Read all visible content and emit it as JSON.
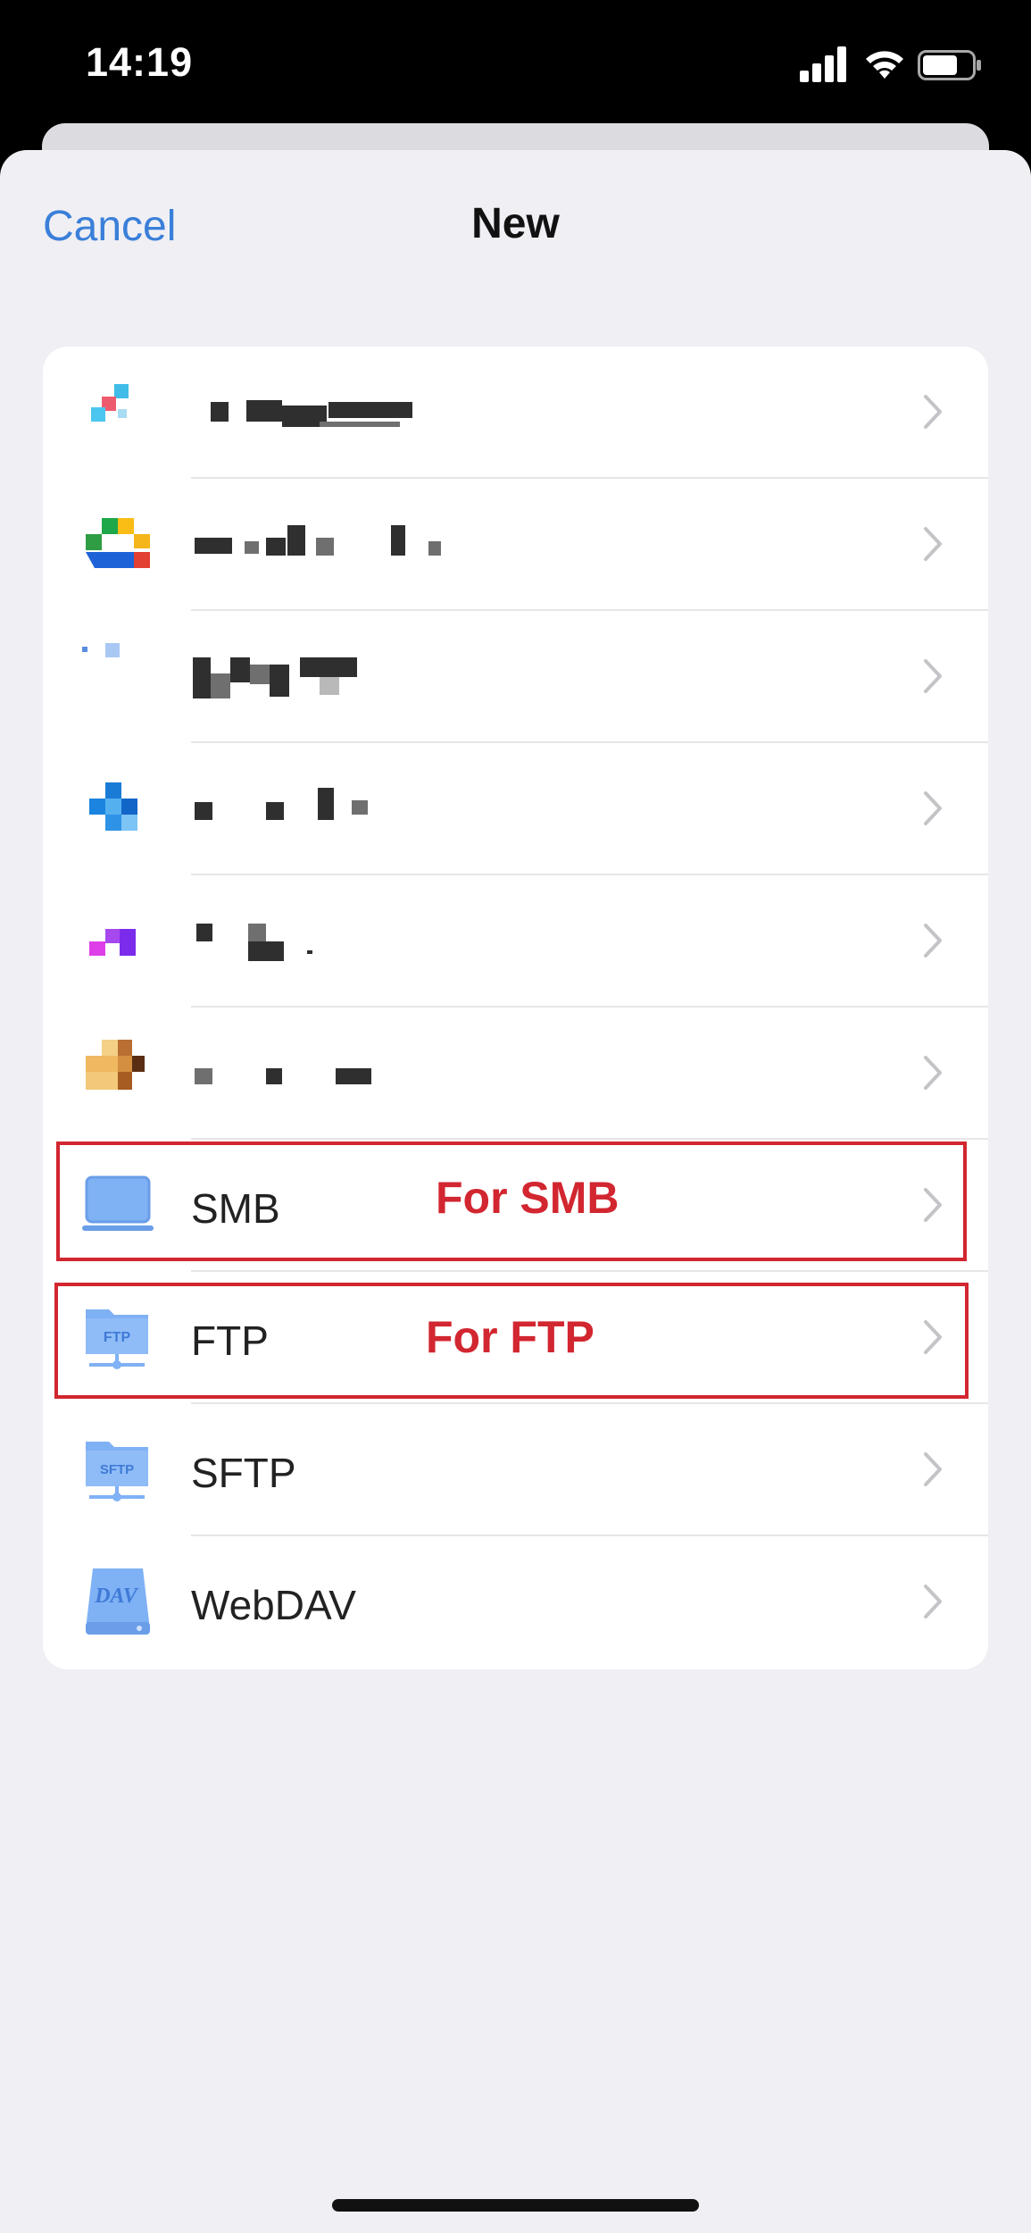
{
  "status_bar": {
    "time": "14:19"
  },
  "header": {
    "cancel_label": "Cancel",
    "title": "New"
  },
  "services": [
    {
      "label": "",
      "icon": "app-icon-1"
    },
    {
      "label": "",
      "icon": "app-icon-2"
    },
    {
      "label": "",
      "icon": "app-icon-3"
    },
    {
      "label": "",
      "icon": "app-icon-4"
    },
    {
      "label": "",
      "icon": "app-icon-5"
    },
    {
      "label": "",
      "icon": "app-icon-6"
    },
    {
      "label": "SMB",
      "icon": "laptop-icon"
    },
    {
      "label": "FTP",
      "icon": "ftp-folder-icon"
    },
    {
      "label": "SFTP",
      "icon": "sftp-folder-icon"
    },
    {
      "label": "WebDAV",
      "icon": "webdav-drive-icon"
    }
  ],
  "annotations": {
    "smb": "For SMB",
    "ftp": "For FTP"
  },
  "colors": {
    "accent": "#3a7fd9",
    "annotation": "#d22630",
    "icon_blue": "#7fb1f5"
  }
}
